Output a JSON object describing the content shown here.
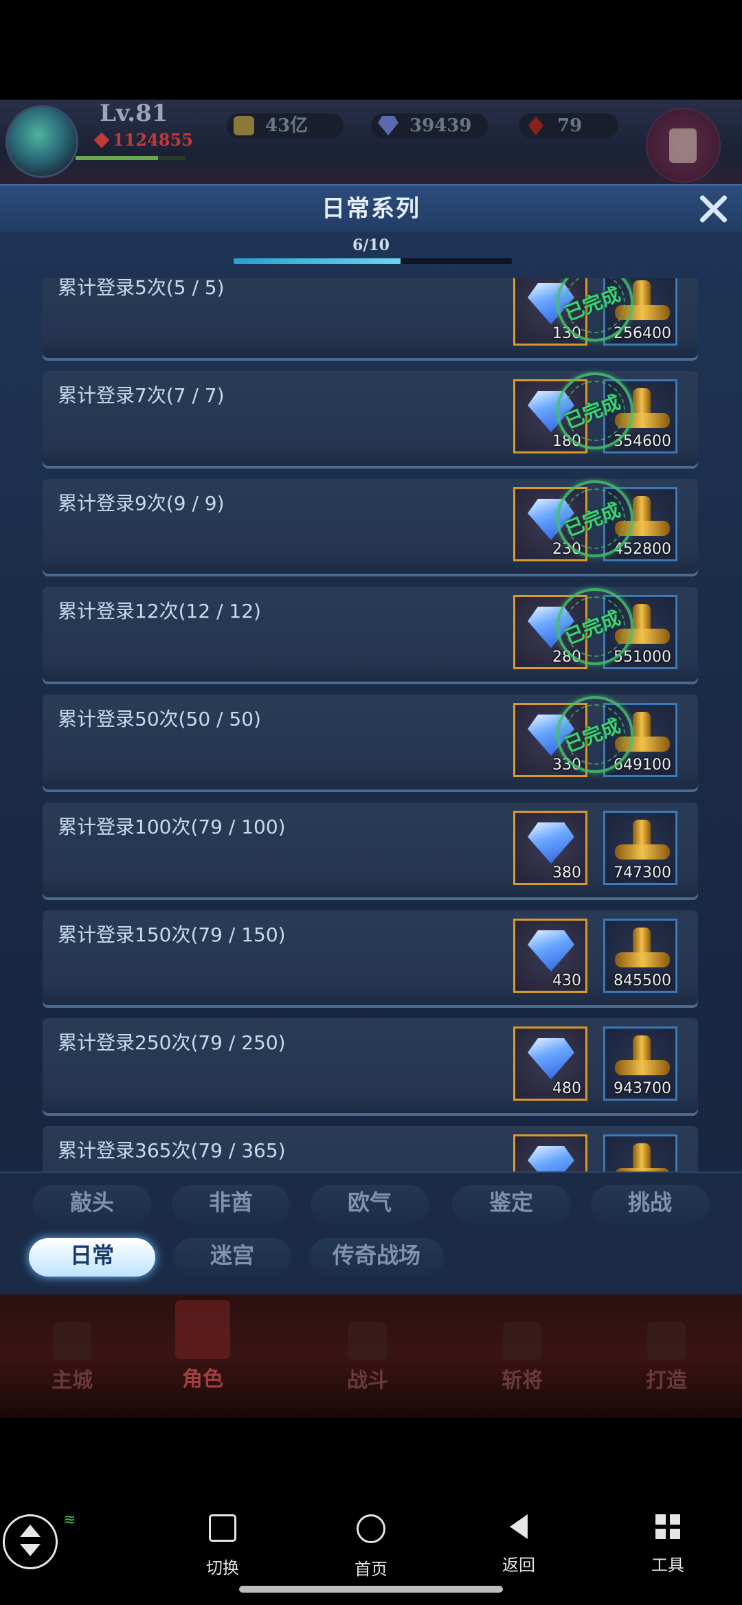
{
  "hud": {
    "level": "Lv.81",
    "power": "1124855",
    "resources": [
      {
        "icon": "gold-ingot-icon",
        "value": "43亿"
      },
      {
        "icon": "diamond-icon",
        "value": "39439"
      },
      {
        "icon": "ruby-icon",
        "value": "79"
      }
    ]
  },
  "panel": {
    "title": "日常系列",
    "progress_text": "6/10",
    "progress_fraction": 0.6,
    "completed_stamp": "已完成",
    "items": [
      {
        "label": "累计登录5次(5 / 5)",
        "gem": "130",
        "gold": "256400",
        "completed": true
      },
      {
        "label": "累计登录7次(7 / 7)",
        "gem": "180",
        "gold": "354600",
        "completed": true
      },
      {
        "label": "累计登录9次(9 / 9)",
        "gem": "230",
        "gold": "452800",
        "completed": true
      },
      {
        "label": "累计登录12次(12 / 12)",
        "gem": "280",
        "gold": "551000",
        "completed": true
      },
      {
        "label": "累计登录50次(50 / 50)",
        "gem": "330",
        "gold": "649100",
        "completed": true
      },
      {
        "label": "累计登录100次(79 / 100)",
        "gem": "380",
        "gold": "747300",
        "completed": false
      },
      {
        "label": "累计登录150次(79 / 150)",
        "gem": "430",
        "gold": "845500",
        "completed": false
      },
      {
        "label": "累计登录250次(79 / 250)",
        "gem": "480",
        "gold": "943700",
        "completed": false
      },
      {
        "label": "累计登录365次(79 / 365)",
        "gem": "",
        "gold": "",
        "completed": false
      }
    ]
  },
  "tabs": {
    "row1": [
      "敲头",
      "非酋",
      "欧气",
      "鉴定",
      "挑战"
    ],
    "row2": [
      "日常",
      "迷宫",
      "传奇战场"
    ],
    "active": "日常"
  },
  "game_nav": [
    "主城",
    "角色",
    "战斗",
    "斩将",
    "打造"
  ],
  "system_nav": {
    "switch": "切换",
    "home": "首页",
    "back": "返回",
    "tools": "工具"
  }
}
